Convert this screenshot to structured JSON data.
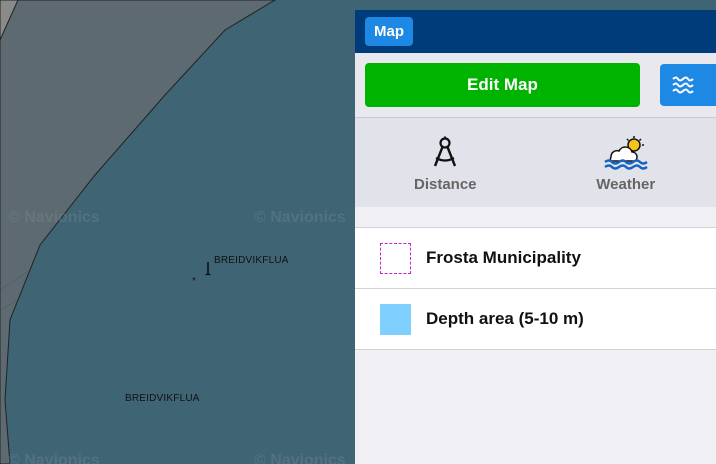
{
  "map": {
    "labels": [
      "BREIDVIKFLUA",
      "BREIDVIKFLUA"
    ],
    "watermark": "© Navionics",
    "colors": {
      "sea": "#3f6474",
      "land": "#5d6870",
      "shallow": "#5f6d73"
    }
  },
  "panel": {
    "tab_label": "Map",
    "edit_button_label": "Edit Map",
    "layers_icon": "waves-icon",
    "tools": [
      {
        "label": "Distance",
        "icon": "compass-icon"
      },
      {
        "label": "Weather",
        "icon": "weather-sun-cloud-waves-icon"
      }
    ],
    "legend": [
      {
        "label": "Frosta Municipality",
        "swatch": "dashed-magenta-border"
      },
      {
        "label": "Depth area (5-10 m)",
        "swatch": "#7fd0ff"
      }
    ],
    "colors": {
      "header": "#003b7a",
      "tab": "#1e88e5",
      "edit_button": "#00b300"
    }
  }
}
